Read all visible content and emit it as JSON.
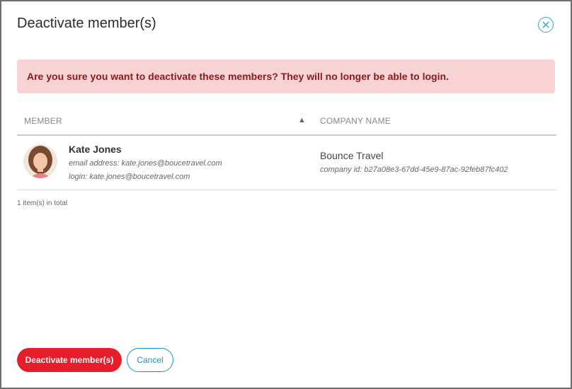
{
  "dialog": {
    "title": "Deactivate member(s)",
    "close_icon": "close-circle-icon"
  },
  "alert": {
    "message": "Are you sure you want to deactivate these members? They will no longer be able to login."
  },
  "table": {
    "columns": [
      {
        "label": "MEMBER",
        "sort_icon": "sort-asc-icon"
      },
      {
        "label": "COMPANY NAME"
      }
    ],
    "rows": [
      {
        "avatar_icon": "avatar-photo",
        "name": "Kate Jones",
        "email_line": "email address: kate.jones@boucetravel.com",
        "login_line": "login: kate.jones@boucetravel.com",
        "company_name": "Bounce Travel",
        "company_id_line": "company id: b27a08e3-67dd-45e9-87ac-92feb87fc402"
      }
    ],
    "total_text": "1 item(s) in total"
  },
  "footer": {
    "primary_label": "Deactivate member(s)",
    "secondary_label": "Cancel"
  },
  "colors": {
    "accent_red": "#e61e2b",
    "alert_bg": "#f8d3d5",
    "alert_text": "#8b1a1a",
    "link_blue": "#1a8fc7"
  }
}
